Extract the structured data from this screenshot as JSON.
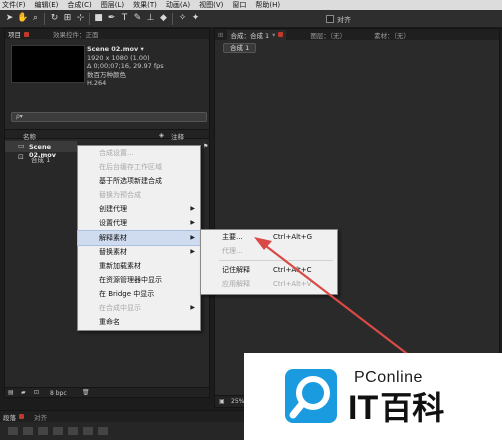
{
  "menubar": [
    "文件(F)",
    "编辑(E)",
    "合成(C)",
    "图层(L)",
    "效果(T)",
    "动画(A)",
    "视图(V)",
    "窗口",
    "帮助(H)"
  ],
  "toolbar": {
    "checkbox_label": "对齐"
  },
  "project_panel": {
    "tabs": [
      {
        "label": "项目"
      },
      {
        "label": "效果控件：正面"
      }
    ],
    "footage": {
      "name": "Scene 02.mov ▾",
      "dims": "1920 x 1080 (1.00)",
      "duration": "Δ 0;00;07;16, 29.97 fps",
      "colors": "数百万种颜色",
      "codec": "H.264"
    },
    "search_placeholder": "ρ▾",
    "col_name": "名称",
    "col_comment": "注释",
    "rows": [
      {
        "name": "Scene 02.mov",
        "icon": "film-icon"
      },
      {
        "name": "合成 1",
        "icon": "composition-icon"
      }
    ],
    "bpc": "8 bpc"
  },
  "comp_panel": {
    "tabs": [
      {
        "label": "合成：合成 1"
      },
      {
        "label": "图层：（无）"
      },
      {
        "label": "素材：（无）"
      }
    ],
    "crumb": "合成 1",
    "zoom": "25%"
  },
  "timeline": {
    "tabs": [
      {
        "label": "段落"
      },
      {
        "label": "对齐"
      }
    ]
  },
  "context_menu": {
    "items": [
      {
        "label": "合成设置...",
        "disabled": true,
        "submenu": false
      },
      {
        "label": "在后台缓存工作区域",
        "disabled": true,
        "submenu": false
      },
      {
        "label": "基于所选项新建合成",
        "disabled": false,
        "submenu": false
      },
      {
        "label": "替换为预合成",
        "disabled": true,
        "submenu": false
      },
      {
        "label": "创建代理",
        "disabled": false,
        "submenu": true
      },
      {
        "label": "设置代理",
        "disabled": false,
        "submenu": true
      },
      {
        "label": "解释素材",
        "disabled": false,
        "submenu": true,
        "highlighted": true
      },
      {
        "label": "替换素材",
        "disabled": false,
        "submenu": true
      },
      {
        "label": "重新加载素材",
        "disabled": false,
        "submenu": false
      },
      {
        "label": "在资源管理器中显示",
        "disabled": false,
        "submenu": false
      },
      {
        "label": "在 Bridge 中显示",
        "disabled": false,
        "submenu": false
      },
      {
        "label": "在合成中显示",
        "disabled": true,
        "submenu": true
      },
      {
        "label": "重命名",
        "disabled": false,
        "submenu": false
      }
    ]
  },
  "submenu": {
    "items": [
      {
        "label": "主要...",
        "shortcut": "Ctrl+Alt+G",
        "disabled": false
      },
      {
        "label": "代理...",
        "shortcut": "",
        "disabled": true
      },
      {
        "separator": true
      },
      {
        "label": "记住解释",
        "shortcut": "Ctrl+Alt+C",
        "disabled": false
      },
      {
        "label": "应用解释",
        "shortcut": "Ctrl+Alt+V",
        "disabled": true
      }
    ]
  },
  "watermark": {
    "brand": "PConline",
    "name_it": "IT",
    "name_cn": "百科"
  },
  "colors": {
    "arrow": "#d94a46",
    "watermark_blue": "#1a9be0",
    "tab_close": "#c0392b"
  }
}
